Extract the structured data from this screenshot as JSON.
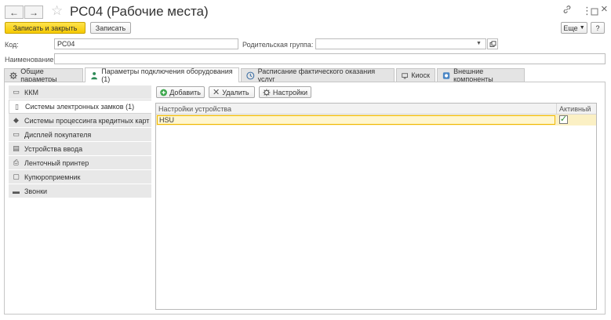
{
  "window": {
    "title": "РС04 (Рабочие места)",
    "back_icon": "←",
    "forward_icon": "→",
    "link_icon": "🔗",
    "more_icon": "⋮",
    "restore_icon": "□",
    "close_icon": "×"
  },
  "toolbar": {
    "save_close_label": "Записать и закрыть",
    "save_label": "Записать",
    "more_label": "Еще",
    "help_label": "?"
  },
  "form": {
    "code_label": "Код:",
    "code_value": "РС04",
    "parent_label": "Родительская группа:",
    "parent_value": "",
    "name_label": "Наименование:",
    "name_value": ""
  },
  "tabs": [
    {
      "label": "Общие параметры",
      "icon": "gear-icon"
    },
    {
      "label": "Параметры подключения оборудования (1)",
      "icon": "person-icon"
    },
    {
      "label": "Расписание фактического оказания услуг",
      "icon": "clock-icon"
    },
    {
      "label": "Киоск",
      "icon": "kiosk-icon"
    },
    {
      "label": "Внешние компоненты",
      "icon": "components-icon"
    }
  ],
  "sidebar": {
    "items": [
      {
        "label": "ККМ"
      },
      {
        "label": "Системы электронных замков (1)"
      },
      {
        "label": "Системы процессинга кредитных карт"
      },
      {
        "label": "Дисплей покупателя"
      },
      {
        "label": "Устройства ввода"
      },
      {
        "label": "Ленточный принтер"
      },
      {
        "label": "Купюроприемник"
      },
      {
        "label": "Звонки"
      }
    ]
  },
  "actions": {
    "add_label": "Добавить",
    "delete_label": "Удалить",
    "settings_label": "Настройки"
  },
  "table": {
    "columns": [
      "Настройки устройства",
      "Активный"
    ],
    "rows": [
      {
        "device": "HSU",
        "active": true
      }
    ],
    "check_mark": "✓"
  },
  "colors": {
    "primary_button": "#f5c900",
    "selected_row": "#fbf0c4",
    "checkbox_mark": "#2e8b2e"
  }
}
